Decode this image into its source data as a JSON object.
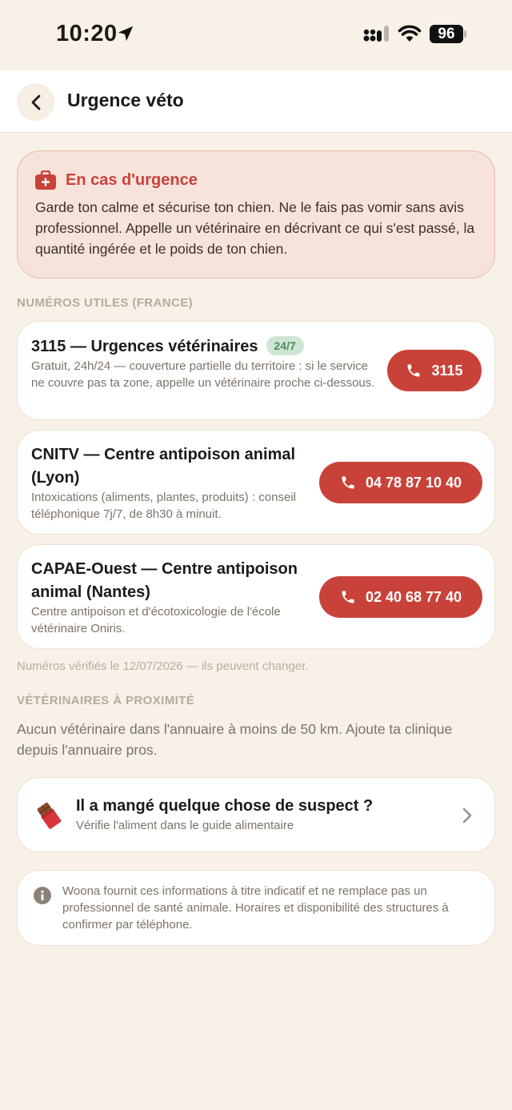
{
  "status_bar": {
    "time": "10:20",
    "battery": "96"
  },
  "header": {
    "title": "Urgence véto"
  },
  "alert": {
    "title": "En cas d'urgence",
    "text": "Garde ton calme et sécurise ton chien. Ne le fais pas vomir sans avis professionnel. Appelle un vétérinaire en décrivant ce qui s'est passé, la quantité ingérée et le poids de ton chien."
  },
  "numbers_section": {
    "label": "NUMÉROS UTILES (FRANCE)"
  },
  "numbers": [
    {
      "title": "3115 — Urgences vétérinaires",
      "badge": "24/7",
      "desc": "Gratuit, 24h/24 — couverture partielle du territoire : si le service ne couvre pas ta zone, appelle un vétérinaire proche ci-dessous.",
      "call_label": "3115"
    },
    {
      "title": "CNITV — Centre antipoison animal (Lyon)",
      "desc": "Intoxications (aliments, plantes, produits) : conseil téléphonique 7j/7, de 8h30 à minuit.",
      "call_label": "04 78 87 10 40"
    },
    {
      "title": "CAPAE-Ouest — Centre antipoison animal (Nantes)",
      "desc": "Centre antipoison et d'écotoxicologie de l'école vétérinaire Oniris.",
      "call_label": "02 40 68 77 40"
    }
  ],
  "verified_note": "Numéros vérifiés le 12/07/2026 — ils peuvent changer.",
  "vets_section": {
    "label": "VÉTÉRINAIRES À PROXIMITÉ",
    "empty_text": "Aucun vétérinaire dans l'annuaire à moins de 50 km. Ajoute ta clinique depuis l'annuaire pros."
  },
  "suspect_card": {
    "title": "Il a mangé quelque chose de suspect ?",
    "subtitle": "Vérifie l'aliment dans le guide alimentaire"
  },
  "disclaimer": "Woona fournit ces informations à titre indicatif et ne remplace pas un professionnel de santé animale. Horaires et disponibilité des structures à confirmer par téléphone.",
  "colors": {
    "accent": "#c9423a",
    "background": "#f7f1e8",
    "alert_bg": "#f8e3db",
    "badge_bg": "#cfe6d4"
  }
}
